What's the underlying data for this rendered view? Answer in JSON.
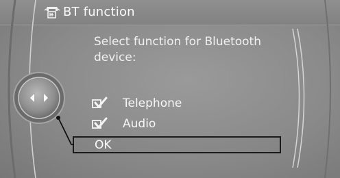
{
  "header": {
    "icon": "bt-settings-icon",
    "title": "BT function"
  },
  "prompt": "Select function for Bluetooth device:",
  "options": [
    {
      "label": "Telephone",
      "checked": true,
      "icon": "checkbox-checked-icon"
    },
    {
      "label": "Audio",
      "checked": true,
      "icon": "checkbox-checked-icon"
    }
  ],
  "confirm": {
    "label": "OK",
    "highlighted": true
  },
  "controller": {
    "icon": "controller-knob-icon",
    "arrows": [
      "left",
      "right"
    ]
  }
}
